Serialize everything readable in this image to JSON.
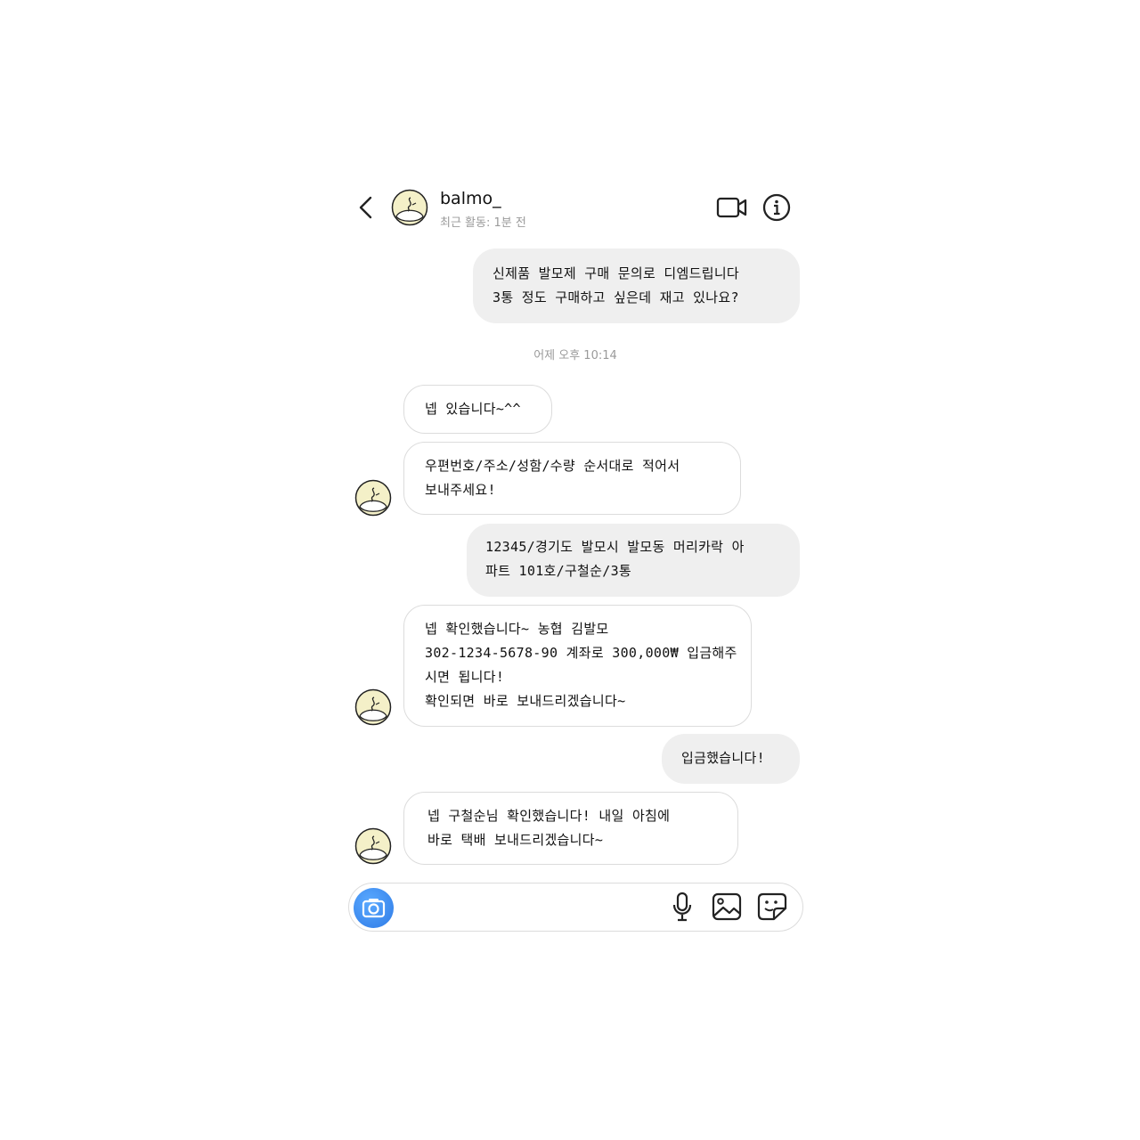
{
  "header": {
    "username": "balmo_",
    "status": "최근 활동: 1분 전"
  },
  "timestamp": "어제 오후 10:14",
  "messages": [
    {
      "from": "me",
      "text": "신제품 발모제 구매 문의로 디엠드립니다\n3통 정도 구매하고 싶은데 재고 있나요?"
    },
    {
      "from": "balmo_",
      "text": "넵 있습니다~^^"
    },
    {
      "from": "balmo_",
      "text": "우편번호/주소/성함/수량 순서대로 적어서\n보내주세요!"
    },
    {
      "from": "me",
      "text": "12345/경기도 발모시 발모동 머리카락 아\n파트 101호/구철순/3통"
    },
    {
      "from": "balmo_",
      "text": "넵 확인했습니다~ 농협 김발모\n302-1234-5678-90 계좌로 300,000₩ 입금해주\n시면 됩니다!\n확인되면 바로 보내드리겠습니다~"
    },
    {
      "from": "me",
      "text": "입금했습니다!"
    },
    {
      "from": "balmo_",
      "text": "넵 구철순님 확인했습니다! 내일 아침에\n바로 택배 보내드리겠습니다~"
    }
  ],
  "composer": {
    "placeholder": "",
    "icons": [
      "camera-icon",
      "microphone-icon",
      "image-icon",
      "sticker-icon"
    ]
  },
  "colors": {
    "sent_bubble": "#efefef",
    "received_border": "#dcdcdc",
    "camera_button": "#3b8cf0",
    "muted_text": "#9a9a9a"
  }
}
